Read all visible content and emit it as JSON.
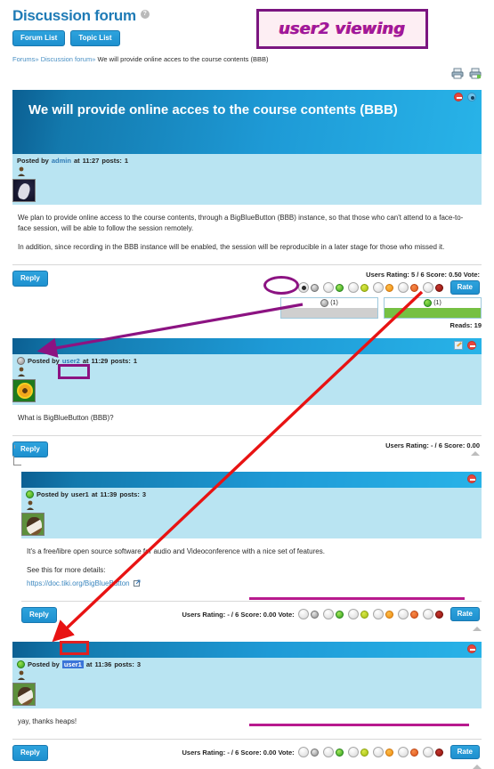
{
  "header": {
    "title": "Discussion forum",
    "help_icon": "help-icon",
    "buttons": [
      {
        "label": "Forum List",
        "name": "forum-list-button"
      },
      {
        "label": "Topic List",
        "name": "topic-list-button"
      }
    ],
    "breadcrumb": {
      "root": "Forums",
      "sep": "»",
      "forum": "Discussion forum",
      "current": "We will provide online acces to the course contents (BBB)"
    },
    "print_icons": [
      "print-icon",
      "print-to-pdf-icon"
    ]
  },
  "annotation": {
    "label": "user2 viewing",
    "border_color": "#7b1580",
    "text_color": "#9b17a0",
    "bg_color": "#fdeef3"
  },
  "topic": {
    "title": "We will provide online acces to the course contents (BBB)",
    "head_icons": [
      "delete-icon",
      "watch-eye-icon"
    ],
    "meta": {
      "posted_by_prefix": "Posted by",
      "author": "admin",
      "at": "at",
      "time": "11:27",
      "posts_label": "posts:",
      "posts_count": "1"
    },
    "avatar": "astronaut-avatar",
    "body": [
      "We plan to provide online access to the course contents, through a BigBlueButton (BBB) instance, so that those who can't attend to a face-to-face session, will be able to follow the session remotely.",
      "In addition, since recording in the BBB instance will be enabled, the session will be reproducible in a later stage for those who missed it."
    ],
    "reply_label": "Reply",
    "rating_text": "Users Rating: 5 / 6 Score: 0.50 Vote:",
    "rate_label": "Rate",
    "selected_option": 0,
    "histogram": [
      {
        "face": "gray",
        "count": "(1)",
        "bar": "gray",
        "fill": 100
      },
      {
        "face": "green",
        "count": "(1)",
        "bar": "green",
        "fill": 100
      }
    ],
    "reads_label": "Reads:",
    "reads_value": "19"
  },
  "replies": [
    {
      "head_icons": [
        "edit-icon",
        "delete-icon"
      ],
      "meta": {
        "face": "gray",
        "posted_by_prefix": "Posted by",
        "author": "user2",
        "at": "at",
        "time": "11:29",
        "posts_label": "posts:",
        "posts_count": "1"
      },
      "avatar": "sunflower-avatar",
      "body": [
        "What is BigBlueButton (BBB)?"
      ],
      "reply_label": "Reply",
      "rating_text": "Users Rating: - / 6 Score: 0.00",
      "has_vote": false
    },
    {
      "head_icons": [
        "delete-icon"
      ],
      "meta": {
        "face": "green",
        "posted_by_prefix": "Posted by",
        "author": "user1",
        "at": "at",
        "time": "11:39",
        "posts_label": "posts:",
        "posts_count": "3"
      },
      "avatar": "dog-avatar",
      "body": [
        "It's a free/libre open source software for audio and Videoconference with a nice set of features.",
        "See this for more details:"
      ],
      "link": "https://doc.tiki.org/BigBlueButton",
      "link_icon": "external-link-icon",
      "reply_label": "Reply",
      "rating_text": "Users Rating: - / 6 Score: 0.00 Vote:",
      "rate_label": "Rate",
      "has_vote": true
    },
    {
      "head_icons": [
        "delete-icon"
      ],
      "meta": {
        "face": "green",
        "posted_by_prefix": "Posted by",
        "author": "user1",
        "at": "at",
        "time": "11:36",
        "posts_label": "posts:",
        "posts_count": "3"
      },
      "avatar": "dog-avatar",
      "body": [
        "yay, thanks heaps!"
      ],
      "reply_label": "Reply",
      "rating_text": "Users Rating: - / 6 Score: 0.00 Vote:",
      "rate_label": "Rate",
      "has_vote": true
    }
  ],
  "vote_faces": [
    "gray",
    "green",
    "yellow-green",
    "orange",
    "red-orange",
    "dark-red"
  ]
}
